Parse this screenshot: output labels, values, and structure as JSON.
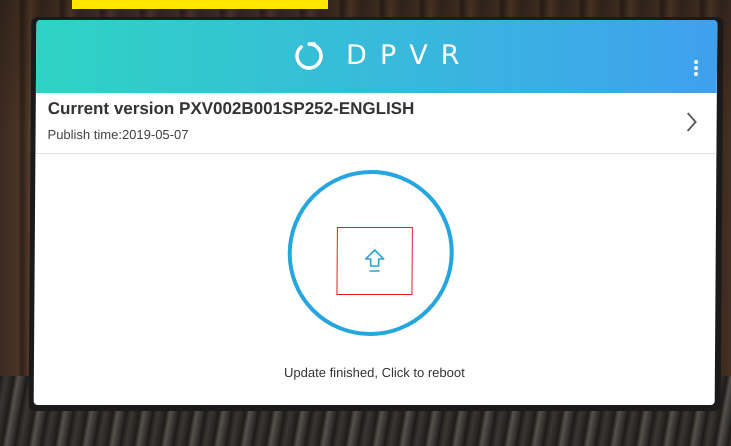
{
  "brand": {
    "name": "DPVR",
    "accent_gradient": [
      "#2ed3c3",
      "#3fa0ee"
    ],
    "circle_color": "#25a6df"
  },
  "header": {
    "menu_icon": "more-vertical-icon"
  },
  "version": {
    "title": "Current version PXV002B001SP252-ENGLISH",
    "publish_time": "Publish time:2019-05-07",
    "chevron_icon": "chevron-right-icon"
  },
  "update": {
    "icon": "upload-arrow-icon",
    "status_text": "Update finished, Click to reboot",
    "highlight_color": "#e02020"
  }
}
